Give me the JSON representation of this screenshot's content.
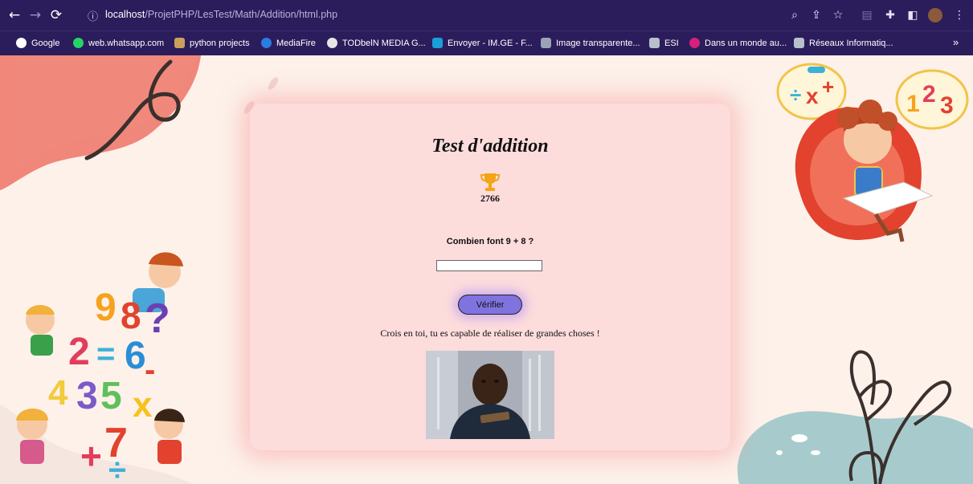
{
  "browser": {
    "url_host": "localhost",
    "url_path": "/ProjetPHP/LesTest/Math/Addition/html.php",
    "bookmarks": [
      "Google",
      "web.whatsapp.com",
      "python projects",
      "MediaFire",
      "TODbelN MEDIA G...",
      "Envoyer - IM.GE - F...",
      "Image transparente...",
      "ESI",
      "Dans un monde au...",
      "Réseaux Informatiq..."
    ],
    "more_bookmarks": "»"
  },
  "test": {
    "title": "Test d'addition",
    "score": "2766",
    "question": "Combien font 9 + 8 ?",
    "answer_value": "",
    "verify_label": "Vérifier",
    "message": "Crois en toi, tu es capable de réaliser de grandes choses !"
  },
  "decor": {
    "numbers_left": [
      "9",
      "8",
      "?",
      "2",
      "=",
      "6",
      "4",
      "3",
      "5",
      "7",
      "+",
      "-",
      "x",
      "÷",
      "1"
    ],
    "numbers_right": [
      "1",
      "2",
      "3"
    ],
    "colors": {
      "accent": "#7f73df",
      "card": "#fddcdc",
      "toolbar": "#2b1d5c"
    }
  }
}
